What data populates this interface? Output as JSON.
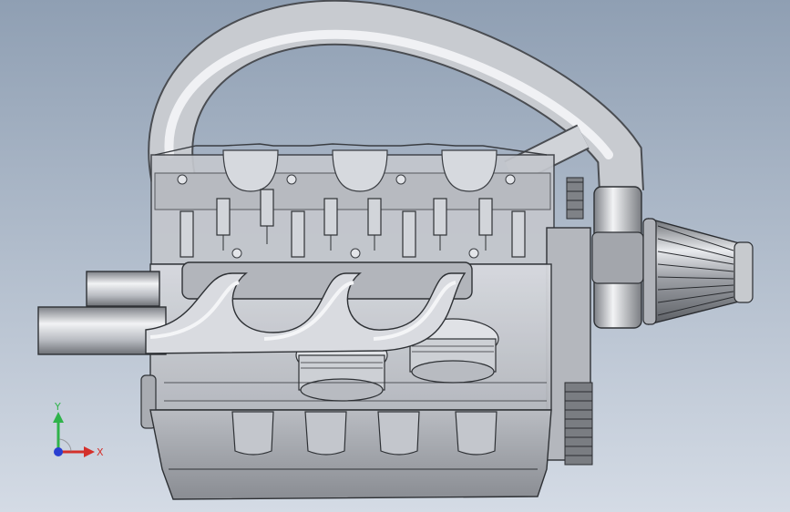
{
  "viewport": {
    "background_top": "#8f9fb3",
    "background_bottom": "#d4dbe5"
  },
  "model": {
    "body_color": "#c9ccd2",
    "edge_color": "#3a3d42",
    "highlight_color": "#eef0f3",
    "shadow_color": "#8d9096"
  },
  "triad": {
    "y_label": "Y",
    "x_label": "X",
    "y_color": "#2fb34a",
    "x_color": "#d4302b",
    "z_color": "#2a3fd1"
  }
}
